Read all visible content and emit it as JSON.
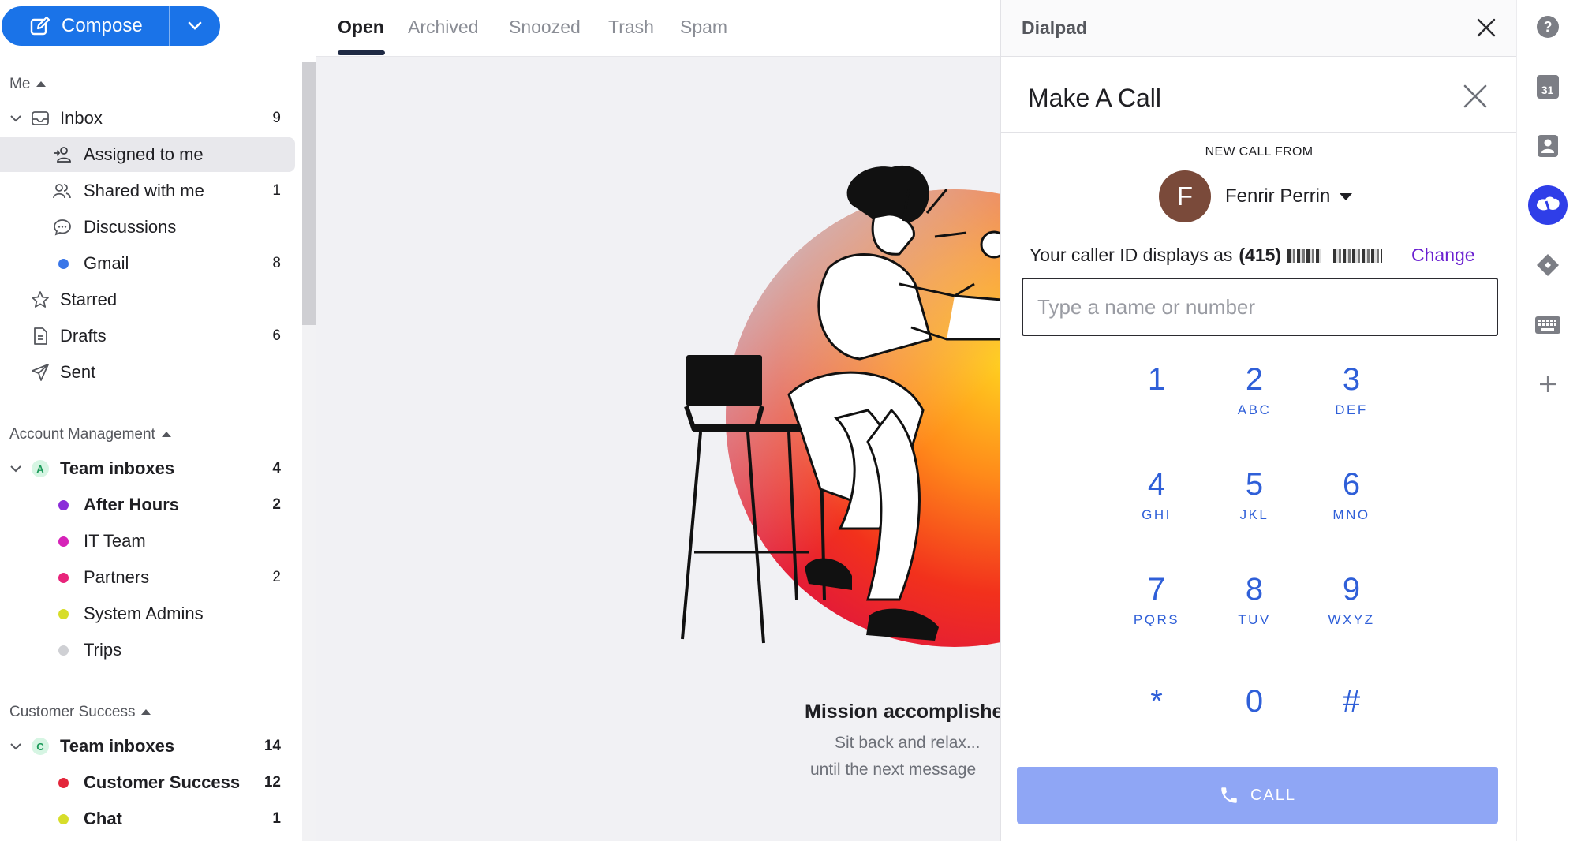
{
  "compose": {
    "label": "Compose"
  },
  "sidebar": {
    "me_header": "Me",
    "me_items": [
      {
        "label": "Inbox",
        "count": "9"
      },
      {
        "label": "Assigned to me",
        "count": ""
      },
      {
        "label": "Shared with me",
        "count": "1"
      },
      {
        "label": "Discussions",
        "count": ""
      },
      {
        "label": "Gmail",
        "count": "8"
      },
      {
        "label": "Starred",
        "count": ""
      },
      {
        "label": "Drafts",
        "count": "6"
      },
      {
        "label": "Sent",
        "count": ""
      }
    ],
    "account_management": {
      "header": "Account Management",
      "team_inboxes_label": "Team inboxes",
      "team_inboxes_badge": "A",
      "team_inboxes_count": "4",
      "inboxes": [
        {
          "label": "After Hours",
          "count": "2",
          "color": "#8b2cd9",
          "bold": true
        },
        {
          "label": "IT Team",
          "count": "",
          "color": "#d623b8",
          "bold": false
        },
        {
          "label": "Partners",
          "count": "2",
          "color": "#e8247b",
          "bold": false
        },
        {
          "label": "System Admins",
          "count": "",
          "color": "#d7dd2a",
          "bold": false
        },
        {
          "label": "Trips",
          "count": "",
          "color": "#cfd0d4",
          "bold": false
        }
      ]
    },
    "customer_success": {
      "header": "Customer Success",
      "team_inboxes_label": "Team inboxes",
      "team_inboxes_badge": "C",
      "team_inboxes_count": "14",
      "inboxes": [
        {
          "label": "Customer Success",
          "count": "12",
          "color": "#e3263b",
          "bold": true
        },
        {
          "label": "Chat",
          "count": "1",
          "color": "#d7dd2a",
          "bold": true
        }
      ]
    }
  },
  "main": {
    "tabs": [
      "Open",
      "Archived",
      "Snoozed",
      "Trash",
      "Spam"
    ],
    "active_tab": "Open",
    "empty_title": "Mission accomplishe",
    "empty_sub1": "Sit back and relax...",
    "empty_sub2": "until the next message"
  },
  "dialpad": {
    "title": "Dialpad",
    "call_title": "Make A Call",
    "new_call_from": "NEW CALL FROM",
    "caller_initial": "F",
    "caller_name": "Fenrir Perrin",
    "caller_id_text": "Your caller ID displays as",
    "caller_id_number": "(415)",
    "change_label": "Change",
    "input_placeholder": "Type a name or number",
    "keys": [
      {
        "digit": "1",
        "letters": ""
      },
      {
        "digit": "2",
        "letters": "ABC"
      },
      {
        "digit": "3",
        "letters": "DEF"
      },
      {
        "digit": "4",
        "letters": "GHI"
      },
      {
        "digit": "5",
        "letters": "JKL"
      },
      {
        "digit": "6",
        "letters": "MNO"
      },
      {
        "digit": "7",
        "letters": "PQRS"
      },
      {
        "digit": "8",
        "letters": "TUV"
      },
      {
        "digit": "9",
        "letters": "WXYZ"
      },
      {
        "digit": "*",
        "letters": ""
      },
      {
        "digit": "0",
        "letters": ""
      },
      {
        "digit": "#",
        "letters": ""
      }
    ],
    "call_label": "CALL"
  },
  "rail": {
    "calendar_day": "31",
    "icons": [
      "help-icon",
      "calendar-icon",
      "contacts-icon",
      "dialpad-app-icon",
      "diamond-app-icon",
      "keyboard-icon",
      "add-icon"
    ]
  },
  "colors": {
    "accent": "#1a73e8",
    "dial_blue": "#2f5fd8",
    "call_button": "#8fa6f5",
    "link_purple": "#6a1fd0"
  }
}
